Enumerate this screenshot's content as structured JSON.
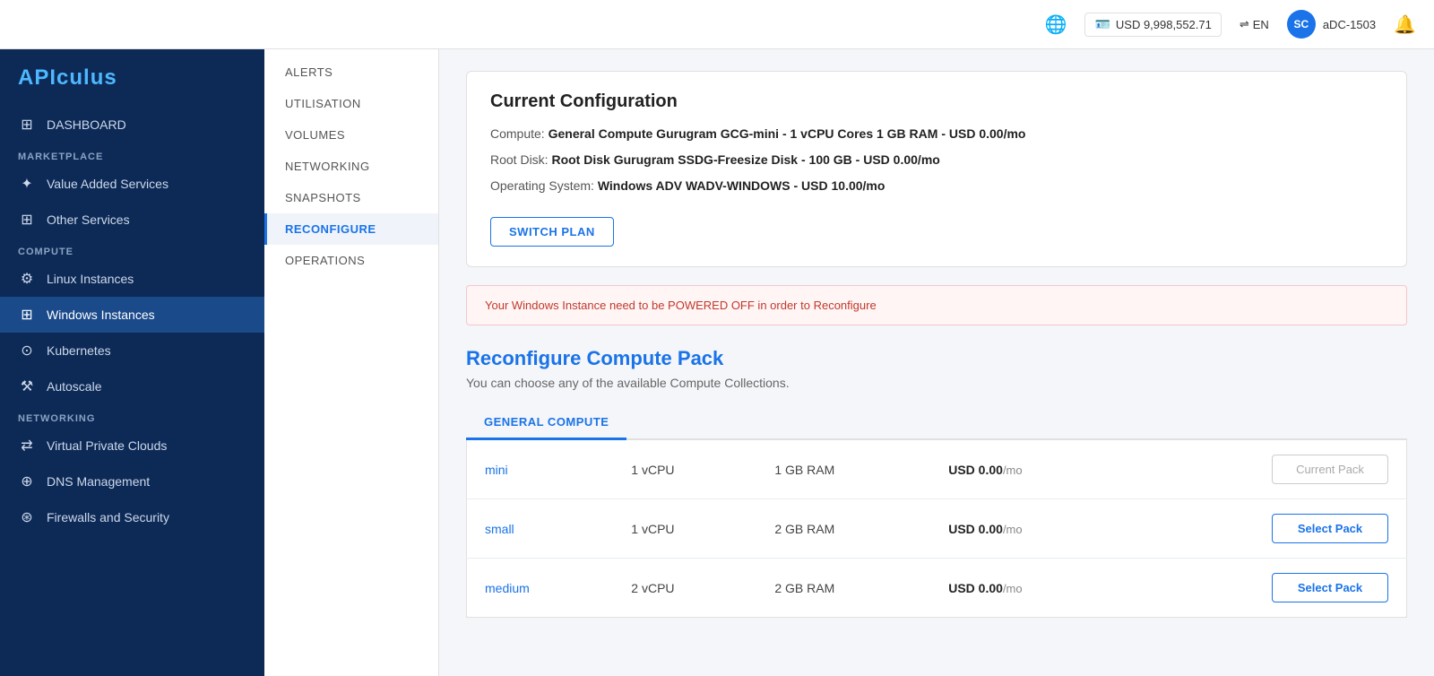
{
  "header": {
    "balance_icon": "💳",
    "balance": "USD 9,998,552.71",
    "lang": "EN",
    "user_initials": "SC",
    "user_name": "aDC-1503",
    "globe_icon": "🌐",
    "bell_icon": "🔔"
  },
  "sidebar": {
    "logo_part1": "API",
    "logo_part2": "culus",
    "dashboard_label": "DASHBOARD",
    "marketplace_label": "MARKETPLACE",
    "compute_label": "COMPUTE",
    "networking_label": "NETWORKING",
    "items": {
      "value_added": "Value Added Services",
      "other_services": "Other Services",
      "linux_instances": "Linux Instances",
      "windows_instances": "Windows Instances",
      "kubernetes": "Kubernetes",
      "autoscale": "Autoscale",
      "vpc": "Virtual Private Clouds",
      "dns": "DNS Management",
      "firewalls": "Firewalls and Security"
    }
  },
  "sub_nav": {
    "items": [
      {
        "label": "ALERTS",
        "active": false
      },
      {
        "label": "UTILISATION",
        "active": false
      },
      {
        "label": "VOLUMES",
        "active": false
      },
      {
        "label": "NETWORKING",
        "active": false
      },
      {
        "label": "SNAPSHOTS",
        "active": false
      },
      {
        "label": "RECONFIGURE",
        "active": true
      },
      {
        "label": "OPERATIONS",
        "active": false
      }
    ]
  },
  "current_config": {
    "title": "Current Configuration",
    "compute_label": "Compute:",
    "compute_value": "General Compute Gurugram GCG-mini - 1 vCPU Cores 1 GB RAM - USD 0.00/mo",
    "root_disk_label": "Root Disk:",
    "root_disk_value": "Root Disk Gurugram SSDG-Freesize Disk - 100 GB - USD 0.00/mo",
    "os_label": "Operating System:",
    "os_value": "Windows ADV WADV-WINDOWS - USD 10.00/mo",
    "switch_plan_label": "SWITCH PLAN"
  },
  "warning": {
    "text": "Your Windows Instance need to be POWERED OFF in order to Reconfigure"
  },
  "reconfigure": {
    "title": "Reconfigure Compute Pack",
    "subtitle": "You can choose any of the available Compute Collections.",
    "tabs": [
      {
        "label": "GENERAL COMPUTE",
        "active": true
      }
    ],
    "packs": [
      {
        "name": "mini",
        "vcpu": "1 vCPU",
        "ram": "1 GB RAM",
        "price": "USD 0.00",
        "price_period": "/mo",
        "is_current": true,
        "btn_label": "Current Pack"
      },
      {
        "name": "small",
        "vcpu": "1 vCPU",
        "ram": "2 GB RAM",
        "price": "USD 0.00",
        "price_period": "/mo",
        "is_current": false,
        "btn_label": "Select Pack"
      },
      {
        "name": "medium",
        "vcpu": "2 vCPU",
        "ram": "2 GB RAM",
        "price": "USD 0.00",
        "price_period": "/mo",
        "is_current": false,
        "btn_label": "Select Pack"
      }
    ]
  }
}
